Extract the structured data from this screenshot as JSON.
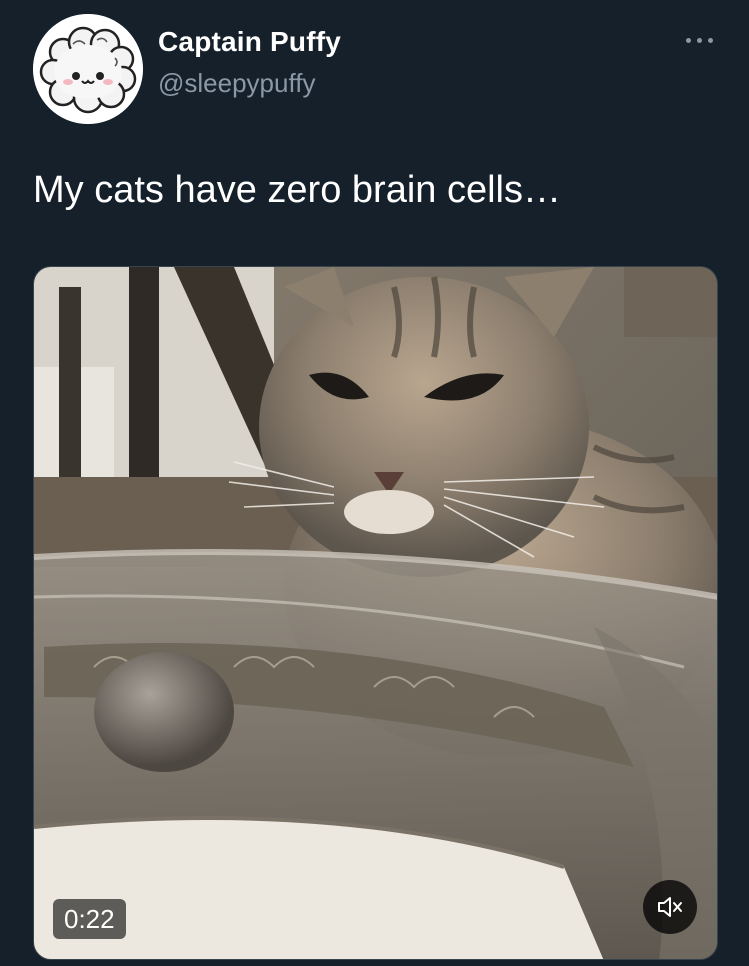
{
  "user": {
    "display_name": "Captain Puffy",
    "handle": "@sleepypuffy",
    "avatar_icon": "fluffy-cloud-creature-avatar"
  },
  "tweet": {
    "text": "My cats have zero brain cells…",
    "more_icon": "more-horizontal-icon"
  },
  "media": {
    "type": "video",
    "description_icon": "video-thumbnail",
    "duration": "0:22",
    "muted": true,
    "mute_icon": "volume-muted-icon"
  },
  "colors": {
    "background": "#15202b",
    "primary_text": "#ffffff",
    "secondary_text": "#8b98a5",
    "border": "#38444d"
  }
}
